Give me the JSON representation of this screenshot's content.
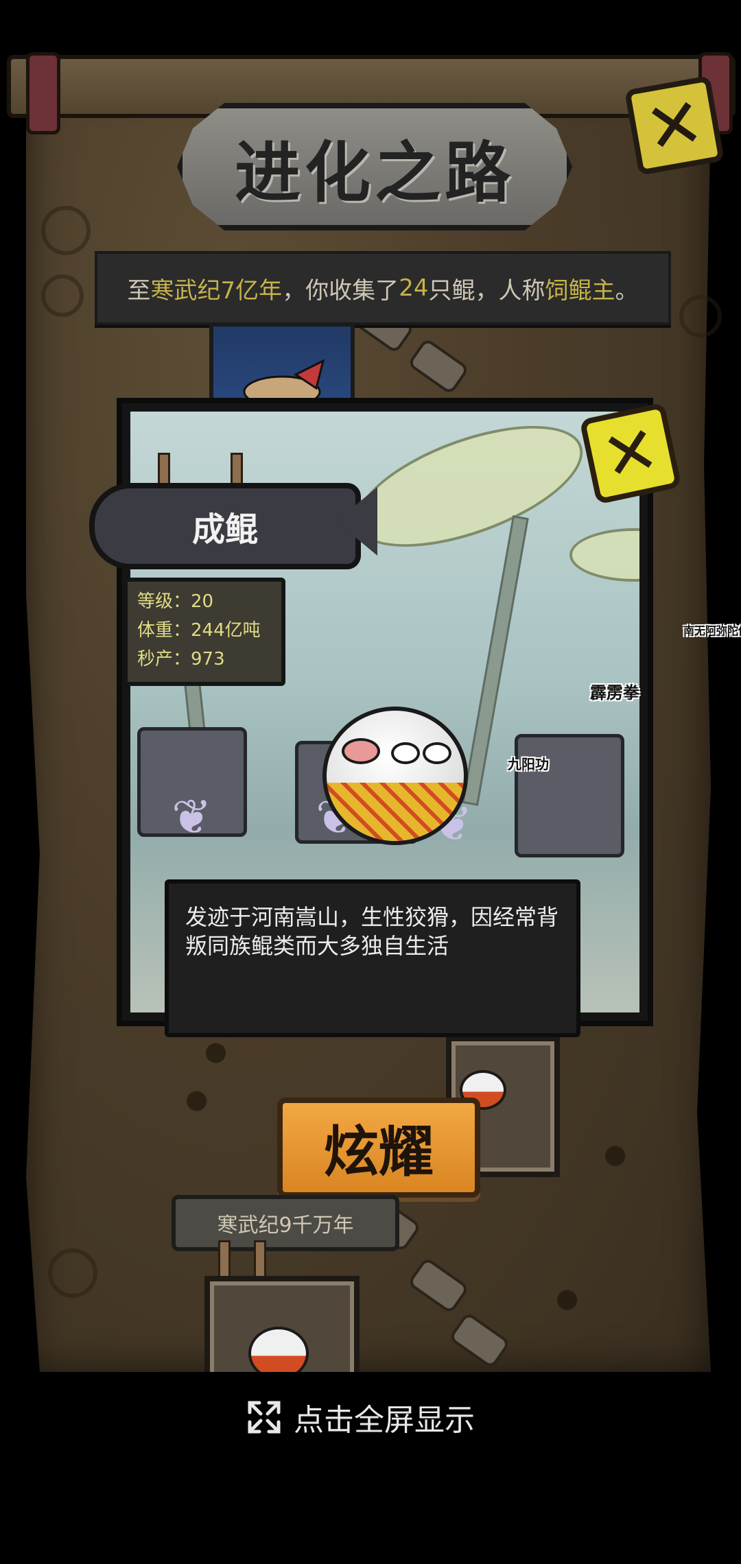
{
  "title": "进化之路",
  "summary": {
    "p1": "至",
    "era": "寒武纪7亿年",
    "p2": "，你收集了",
    "count": "24",
    "p3": "只鲲，人称",
    "honor": "饲鲲主",
    "p4": "。"
  },
  "card": {
    "name": "成鲲",
    "stats": {
      "level": "等级：20",
      "weight": "体重：244亿吨",
      "output": "秒产：973"
    },
    "description": "发迹于河南嵩山，生性狡猾，因经常背叛同族鲲类而大多独自生活"
  },
  "floating_labels": {
    "a": "南无阿弥陀佛",
    "b": "霹雳拳",
    "c": "九阳功"
  },
  "buttons": {
    "show_off": "炫耀",
    "close": "✕",
    "fullscreen": "点击全屏显示"
  },
  "era_label": "寒武纪9千万年",
  "icons": {
    "close": "close-icon",
    "fullscreen": "expand-icon"
  },
  "colors": {
    "highlight": "#c6b24a",
    "close_btn": "#e7df2e",
    "show_off_btn": "#f2a843"
  }
}
